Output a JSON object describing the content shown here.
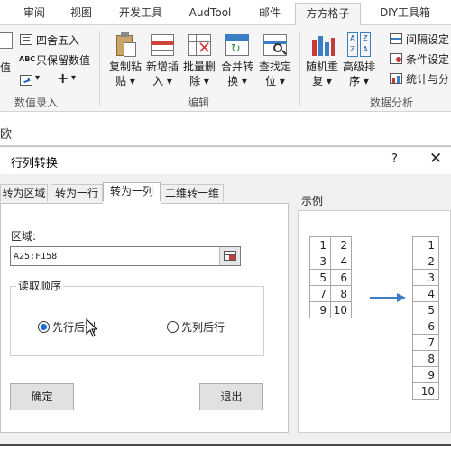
{
  "ribbon_tabs": [
    "审阅",
    "视图",
    "开发工具",
    "AudTool",
    "邮件",
    "方方格子",
    "DIY工具箱"
  ],
  "active_tab": "方方格子",
  "ribbon": {
    "value_label": "值",
    "round_label": "四舍五入",
    "keep_value_label": "只保留数值",
    "abc_label": "ABC",
    "plus_label": "+",
    "group_numeric": "数值录入",
    "btn_copy_paste": [
      "复制粘",
      "贴 ▾"
    ],
    "btn_insert": [
      "新增插",
      "入 ▾"
    ],
    "btn_batch_delete": [
      "批量删",
      "除 ▾"
    ],
    "btn_merge": [
      "合并转",
      "换 ▾"
    ],
    "btn_locate": [
      "查找定",
      "位 ▾"
    ],
    "group_edit": "编辑",
    "btn_random": [
      "随机重",
      "复 ▾"
    ],
    "btn_sort": [
      "高级排",
      "序 ▾"
    ],
    "interval_label": "间隔设定",
    "condition_label": "条件设定",
    "stats_label": "统计与分",
    "group_analysis": "数据分析"
  },
  "formula_bar_char": "欧",
  "dialog": {
    "title": "行列转换",
    "help": "?",
    "close": "✕",
    "tabs": [
      "转为区域",
      "转为一行",
      "转为一列",
      "二维转一维"
    ],
    "active_tab": "转为一列",
    "area_label": "区域:",
    "area_value": "A25:F158",
    "order_label": "读取顺序",
    "radio_row_first": "先行后列",
    "radio_col_first": "先列后行",
    "selected_order": "先行后列",
    "ok_label": "确定",
    "exit_label": "退出",
    "example_label": "示例",
    "example_left": [
      [
        "1",
        "2"
      ],
      [
        "3",
        "4"
      ],
      [
        "5",
        "6"
      ],
      [
        "7",
        "8"
      ],
      [
        "9",
        "10"
      ]
    ],
    "example_right": [
      "1",
      "2",
      "3",
      "4",
      "5",
      "6",
      "7",
      "8",
      "9",
      "10"
    ]
  },
  "colors": {
    "accent": "#1a6fd4",
    "arrow": "#3a7fc4"
  }
}
